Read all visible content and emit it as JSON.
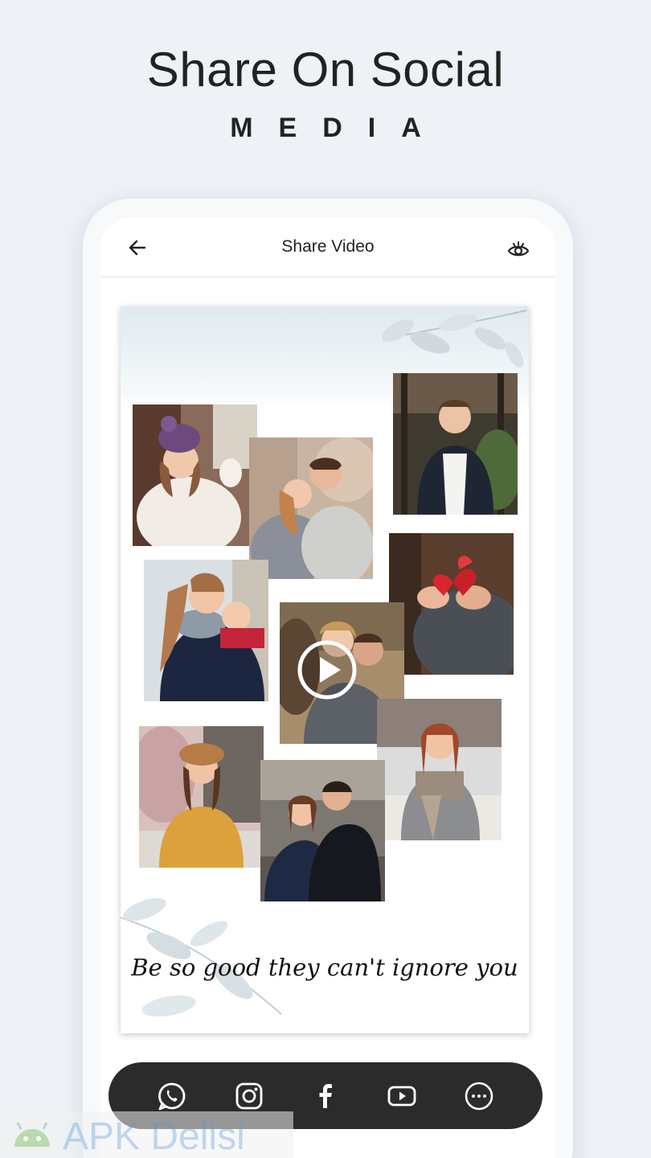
{
  "promo": {
    "headline": "Share On Social",
    "subheadline": "MEDIA"
  },
  "app_bar": {
    "title": "Share Video",
    "back_icon": "arrow-left-icon",
    "preview_icon": "eye-icon"
  },
  "preview": {
    "quote": "Be so good they can't ignore you",
    "play_icon": "play-circle-icon"
  },
  "share_bar": {
    "items": [
      {
        "name": "whatsapp",
        "icon": "whatsapp-icon"
      },
      {
        "name": "instagram",
        "icon": "instagram-icon"
      },
      {
        "name": "facebook",
        "icon": "facebook-icon"
      },
      {
        "name": "youtube",
        "icon": "youtube-icon"
      },
      {
        "name": "more",
        "icon": "more-horizontal-icon"
      }
    ]
  },
  "watermark": {
    "text": "APK Delisi"
  },
  "colors": {
    "background": "#eef2f6",
    "share_bar": "#2b2b2b",
    "text": "#222222"
  }
}
